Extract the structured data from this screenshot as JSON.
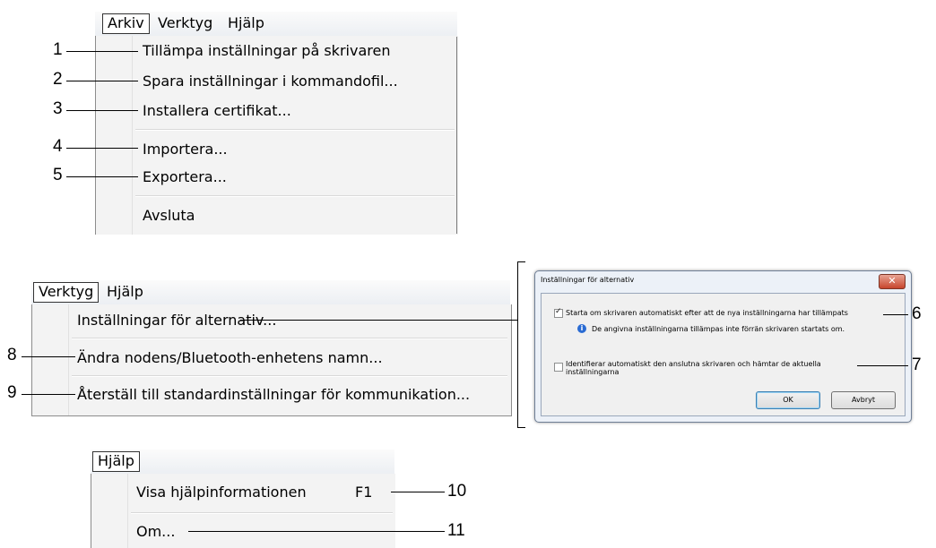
{
  "arkiv_menu": {
    "menubar": [
      "Arkiv",
      "Verktyg",
      "Hjälp"
    ],
    "items": [
      "Tillämpa inställningar på skrivaren",
      "Spara inställningar i kommandofil...",
      "Installera certifikat...",
      "Importera...",
      "Exportera...",
      "Avsluta"
    ],
    "callouts": [
      "1",
      "2",
      "3",
      "4",
      "5"
    ]
  },
  "verktyg_menu": {
    "menubar": [
      "Verktyg",
      "Hjälp"
    ],
    "items": [
      "Inställningar för alternativ...",
      "Ändra nodens/Bluetooth-enhetens namn...",
      "Återställ till standardinställningar för kommunikation..."
    ],
    "callouts": [
      "8",
      "9"
    ]
  },
  "dialog": {
    "title": "Inställningar för alternativ",
    "close_icon": "close-icon",
    "option1": "Starta om skrivaren automatiskt efter att de nya inställningarna har tillämpats",
    "option1_checked": true,
    "info": "De angivna inställningarna tillämpas inte förrän skrivaren startats om.",
    "option2_line1": "Identifierar automatiskt den anslutna skrivaren och hämtar de aktuella",
    "option2_line2": "inställningarna",
    "option2_checked": false,
    "ok": "OK",
    "cancel": "Avbryt",
    "callouts": [
      "6",
      "7"
    ]
  },
  "hjalp_menu": {
    "menubar": [
      "Hjälp"
    ],
    "items": [
      "Visa hjälpinformationen",
      "Om..."
    ],
    "shortcut": "F1",
    "callouts": [
      "10",
      "11"
    ]
  }
}
